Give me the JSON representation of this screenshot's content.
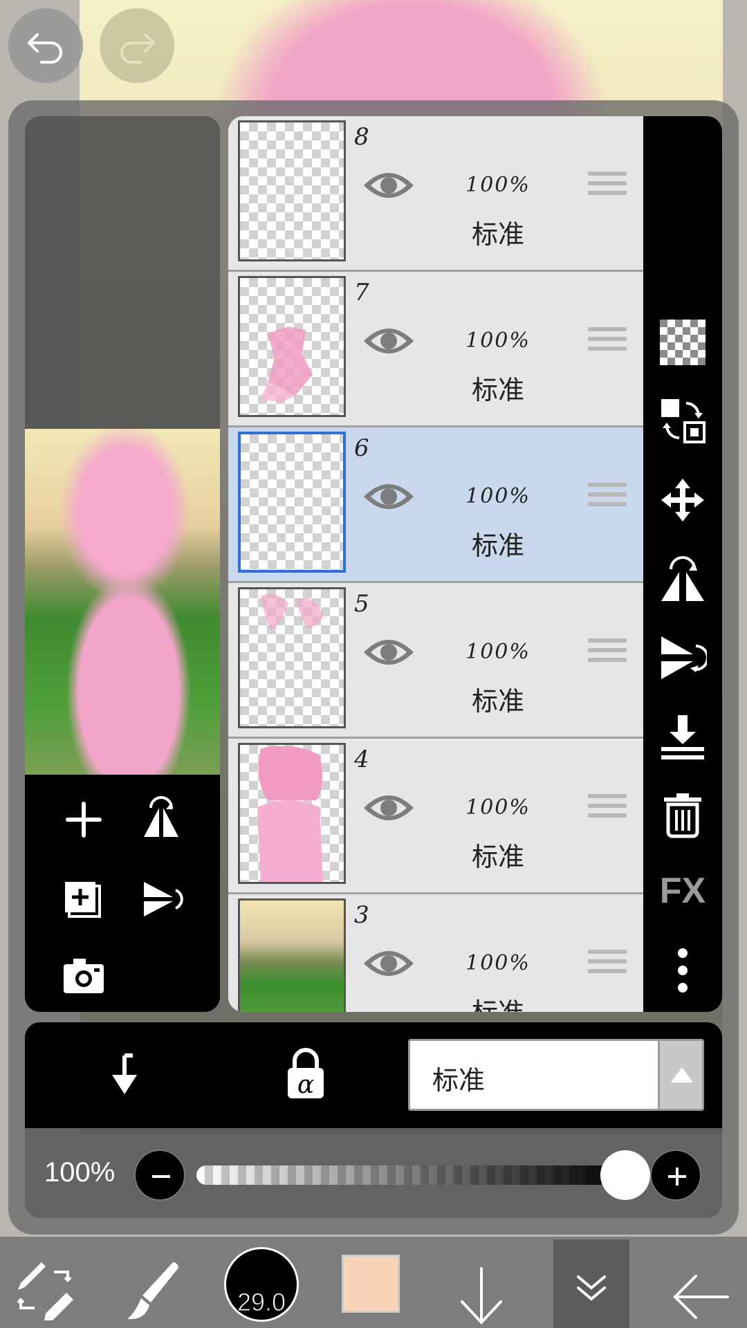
{
  "layers": [
    {
      "number": "8",
      "opacity": "100%",
      "blend": "标准",
      "selected": false
    },
    {
      "number": "7",
      "opacity": "100%",
      "blend": "标准",
      "selected": false
    },
    {
      "number": "6",
      "opacity": "100%",
      "blend": "标准",
      "selected": true
    },
    {
      "number": "5",
      "opacity": "100%",
      "blend": "标准",
      "selected": false
    },
    {
      "number": "4",
      "opacity": "100%",
      "blend": "标准",
      "selected": false
    },
    {
      "number": "3",
      "opacity": "100%",
      "blend": "标准",
      "selected": false
    }
  ],
  "right_toolbar": {
    "fx_label": "FX"
  },
  "blend_mode": {
    "selected": "标准"
  },
  "opacity": {
    "value_label": "100%",
    "value": 1.0
  },
  "brush": {
    "size_label": "29.0"
  },
  "colors": {
    "primary": "#f8d3b8",
    "selected_layer_bg": "#c9d8ec",
    "selected_layer_border": "#2f6fd6"
  }
}
